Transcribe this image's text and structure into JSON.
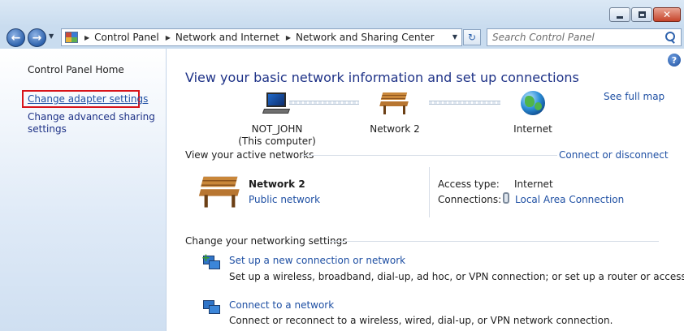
{
  "navbar": {
    "breadcrumbs": [
      "Control Panel",
      "Network and Internet",
      "Network and Sharing Center"
    ],
    "search_placeholder": "Search Control Panel"
  },
  "sidebar": {
    "home": "Control Panel Home",
    "items": [
      {
        "label": "Change adapter settings",
        "highlighted": true
      },
      {
        "label": "Change advanced sharing settings"
      }
    ]
  },
  "main": {
    "title": "View your basic network information and set up connections",
    "see_full_map": "See full map",
    "map": {
      "computer_name": "NOT_JOHN",
      "computer_note": "(This computer)",
      "network": "Network  2",
      "internet": "Internet"
    },
    "active_networks": {
      "heading": "View your active networks",
      "connect_disconnect": "Connect or disconnect",
      "network_name": "Network  2",
      "network_type": "Public network",
      "access_type_label": "Access type:",
      "access_type_value": "Internet",
      "connections_label": "Connections:",
      "connections_value": "Local Area Connection"
    },
    "settings": {
      "heading": "Change your networking settings",
      "tasks": [
        {
          "link": "Set up a new connection or network",
          "desc": "Set up a wireless, broadband, dial-up, ad hoc, or VPN connection; or set up a router or access point."
        },
        {
          "link": "Connect to a network",
          "desc": "Connect or reconnect to a wireless, wired, dial-up, or VPN network connection."
        }
      ]
    }
  },
  "colors": {
    "link": "#1e4fa3",
    "title": "#1e3287",
    "highlight_border": "#d8141a"
  },
  "icons": [
    "back-arrow-icon",
    "forward-arrow-icon",
    "control-panel-icon",
    "refresh-icon",
    "search-icon",
    "help-icon",
    "computer-icon",
    "bench-icon",
    "globe-icon",
    "plug-icon",
    "new-connection-icon",
    "connect-network-icon"
  ]
}
